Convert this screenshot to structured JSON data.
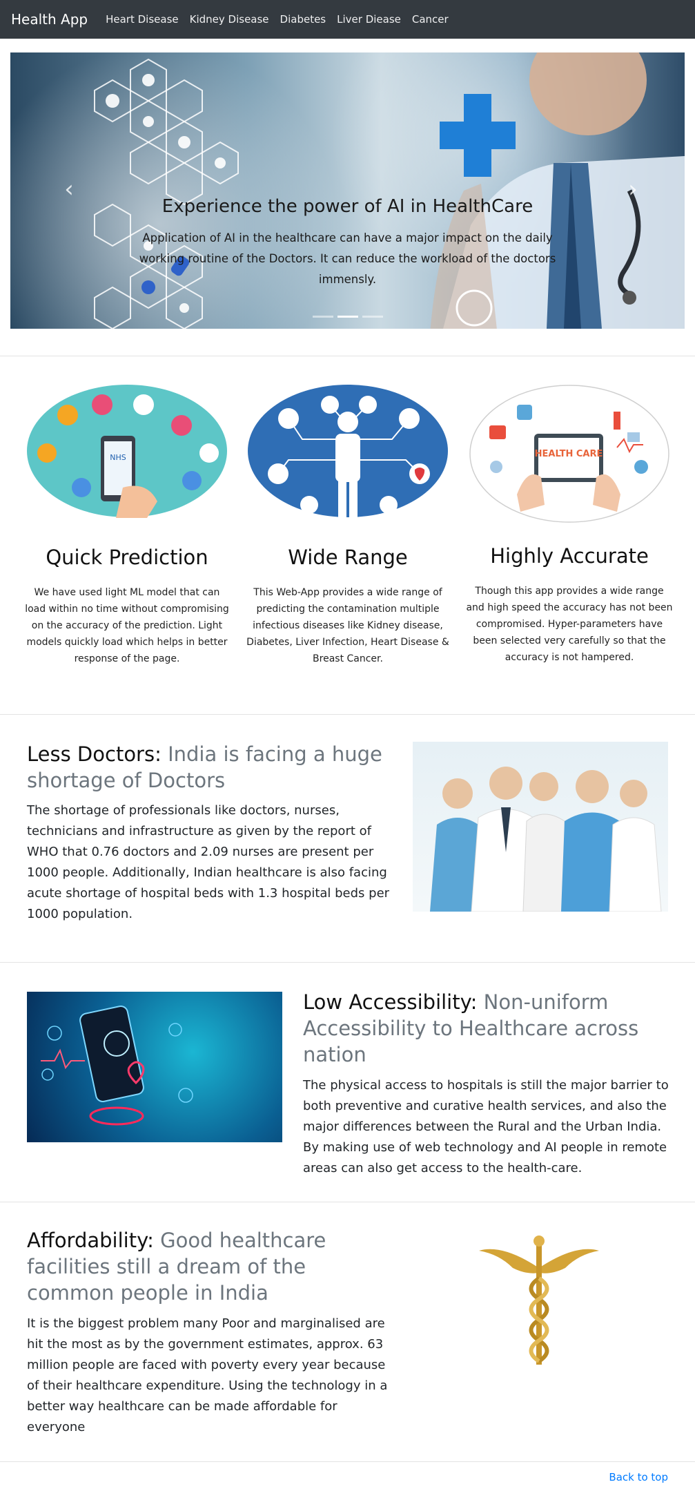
{
  "navbar": {
    "brand": "Health App",
    "links": [
      "Heart Disease",
      "Kidney Disease",
      "Diabetes",
      "Liver Diease",
      "Cancer"
    ]
  },
  "carousel": {
    "title": "Experience the power of AI in HealthCare",
    "text": "Application of AI in the healthcare can have a major impact on the daily working routine of the Doctors. It can reduce the workload of the doctors immensly.",
    "prev_icon": "chevron-left-icon",
    "next_icon": "chevron-right-icon"
  },
  "features": [
    {
      "title": "Quick Prediction",
      "text": "We have used light ML model that can load within no time without compromising on the accuracy of the prediction. Light models quickly load which helps in better response of the page.",
      "image_label": "NHS"
    },
    {
      "title": "Wide Range",
      "text": "This Web-App provides a wide range of predicting the contamination multiple infectious diseases like Kidney disease, Diabetes, Liver Infection, Heart Disease & Breast Cancer."
    },
    {
      "title": "Highly Accurate",
      "text": "Though this app provides a wide range and high speed the accuracy has not been compromised. Hyper-parameters have been selected very carefully so that the accuracy is not hampered.",
      "image_label": "HEALTH CARE"
    }
  ],
  "sections": [
    {
      "strong": "Less Doctors",
      "muted": "India is facing a huge shortage of Doctors",
      "text": "The shortage of professionals like doctors, nurses, technicians and infrastructure as given by the report of WHO that 0.76 doctors and 2.09 nurses are present per 1000 people. Additionally, Indian healthcare is also facing acute shortage of hospital beds with 1.3 hospital beds per 1000 population."
    },
    {
      "strong": "Low Accessibility",
      "muted": "Non-uniform Accessibility to Healthcare across nation",
      "text": "The physical access to hospitals is still the major barrier to both preventive and curative health services, and also the major differences between the Rural and the Urban India. By making use of web technology and AI people in remote areas can also get access to the health-care."
    },
    {
      "strong": "Affordability",
      "muted": "Good healthcare facilities still a dream of the common people in India",
      "text": "It is the biggest problem many Poor and marginalised are hit the most as by the government estimates, approx. 63 million people are faced with poverty every year because of their healthcare expenditure. Using the technology in a better way healthcare can be made affordable for everyone"
    }
  ],
  "footer": {
    "back_to_top": "Back to top"
  },
  "colors": {
    "navbar": "#343a40",
    "link": "#007bff",
    "muted": "#6c757d"
  }
}
